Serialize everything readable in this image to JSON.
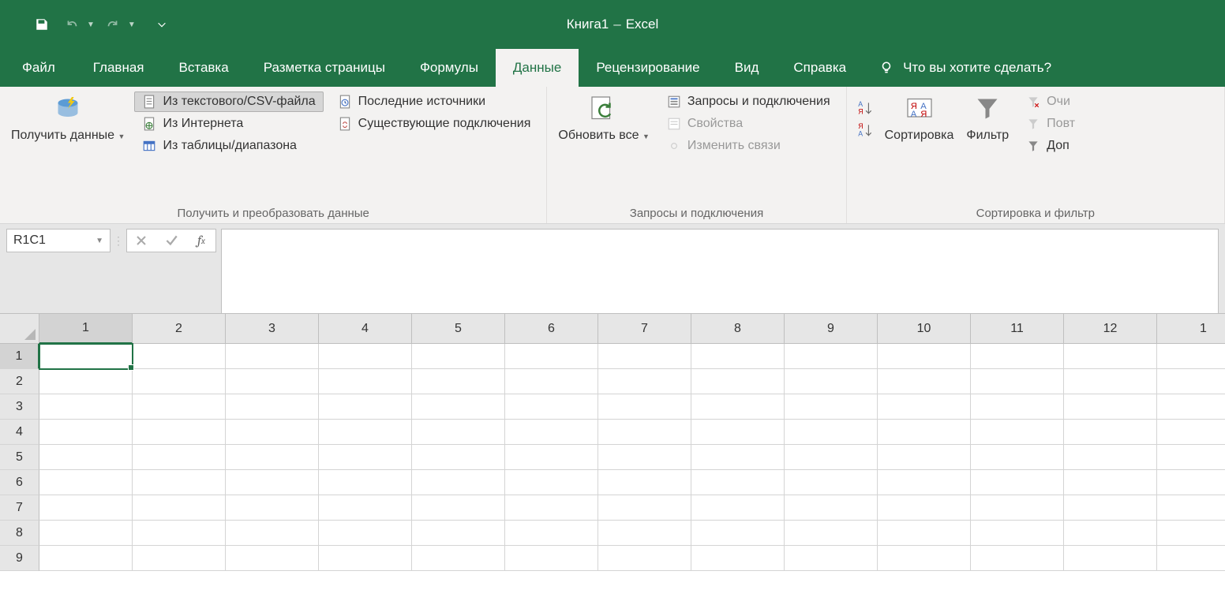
{
  "app": {
    "document": "Книга1",
    "name": "Excel"
  },
  "qat": {
    "save": "Сохранить",
    "undo": "Отменить",
    "redo": "Повторить"
  },
  "tabs": {
    "file": "Файл",
    "items": [
      "Главная",
      "Вставка",
      "Разметка страницы",
      "Формулы",
      "Данные",
      "Рецензирование",
      "Вид",
      "Справка"
    ],
    "active_index": 4,
    "tell_me": "Что вы хотите сделать?"
  },
  "ribbon": {
    "group1": {
      "label": "Получить и преобразовать данные",
      "get_data": "Получить\nданные",
      "from_csv": "Из текстового/CSV-файла",
      "from_web": "Из Интернета",
      "from_table": "Из таблицы/диапазона",
      "recent": "Последние источники",
      "existing": "Существующие подключения"
    },
    "group2": {
      "label": "Запросы и подключения",
      "refresh": "Обновить\nвсе",
      "queries": "Запросы и подключения",
      "props": "Свойства",
      "links": "Изменить связи"
    },
    "group3": {
      "label": "Сортировка и фильтр",
      "sort": "Сортировка",
      "filter": "Фильтр",
      "clear": "Очи",
      "reapply": "Повт",
      "advanced": "Доп"
    }
  },
  "formula_bar": {
    "name_box": "R1C1"
  },
  "grid": {
    "cols": [
      "1",
      "2",
      "3",
      "4",
      "5",
      "6",
      "7",
      "8",
      "9",
      "10",
      "11",
      "12",
      "1"
    ],
    "rows": [
      "1",
      "2",
      "3",
      "4",
      "5",
      "6",
      "7",
      "8",
      "9"
    ],
    "active": {
      "row": 0,
      "col": 0
    }
  }
}
